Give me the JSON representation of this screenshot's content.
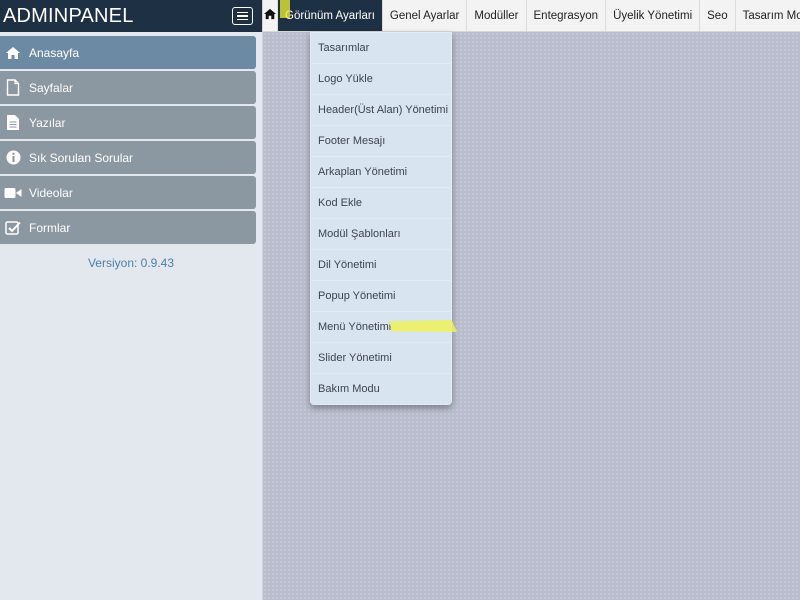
{
  "brand": {
    "title": "ADMINPANEL"
  },
  "sidebar": {
    "items": [
      {
        "label": "Anasayfa",
        "icon": "home-icon"
      },
      {
        "label": "Sayfalar",
        "icon": "page-icon"
      },
      {
        "label": "Yazılar",
        "icon": "document-icon"
      },
      {
        "label": "Sık Sorulan Sorular",
        "icon": "info-icon"
      },
      {
        "label": "Videolar",
        "icon": "video-icon"
      },
      {
        "label": "Formlar",
        "icon": "checkbox-icon"
      }
    ],
    "version": "Versiyon: 0.9.43"
  },
  "topnav": {
    "items": [
      {
        "label": "Görünüm Ayarları"
      },
      {
        "label": "Genel Ayarlar"
      },
      {
        "label": "Modüller"
      },
      {
        "label": "Entegrasyon"
      },
      {
        "label": "Üyelik Yönetimi"
      },
      {
        "label": "Seo"
      },
      {
        "label": "Tasarım Mo"
      }
    ]
  },
  "dropdown": {
    "items": [
      {
        "label": "Tasarımlar"
      },
      {
        "label": "Logo Yükle"
      },
      {
        "label": "Header(Üst Alan) Yönetimi"
      },
      {
        "label": "Footer Mesajı"
      },
      {
        "label": "Arkaplan Yönetimi"
      },
      {
        "label": "Kod Ekle"
      },
      {
        "label": "Modül Şablonları"
      },
      {
        "label": "Dil Yönetimi"
      },
      {
        "label": "Popup Yönetimi"
      },
      {
        "label": "Menü Yönetimi"
      },
      {
        "label": "Slider Yönetimi"
      },
      {
        "label": "Bakım Modu"
      }
    ]
  },
  "colors": {
    "header_bg": "#1e3044",
    "menu_item_bg": "#8b97a1",
    "menu_item_active_bg": "#6d8aa5",
    "content_bg": "#b9bdcd",
    "dropdown_item_bg": "#d8e4ef",
    "version_text": "#4e7fa8",
    "highlight": "#eef25a"
  }
}
